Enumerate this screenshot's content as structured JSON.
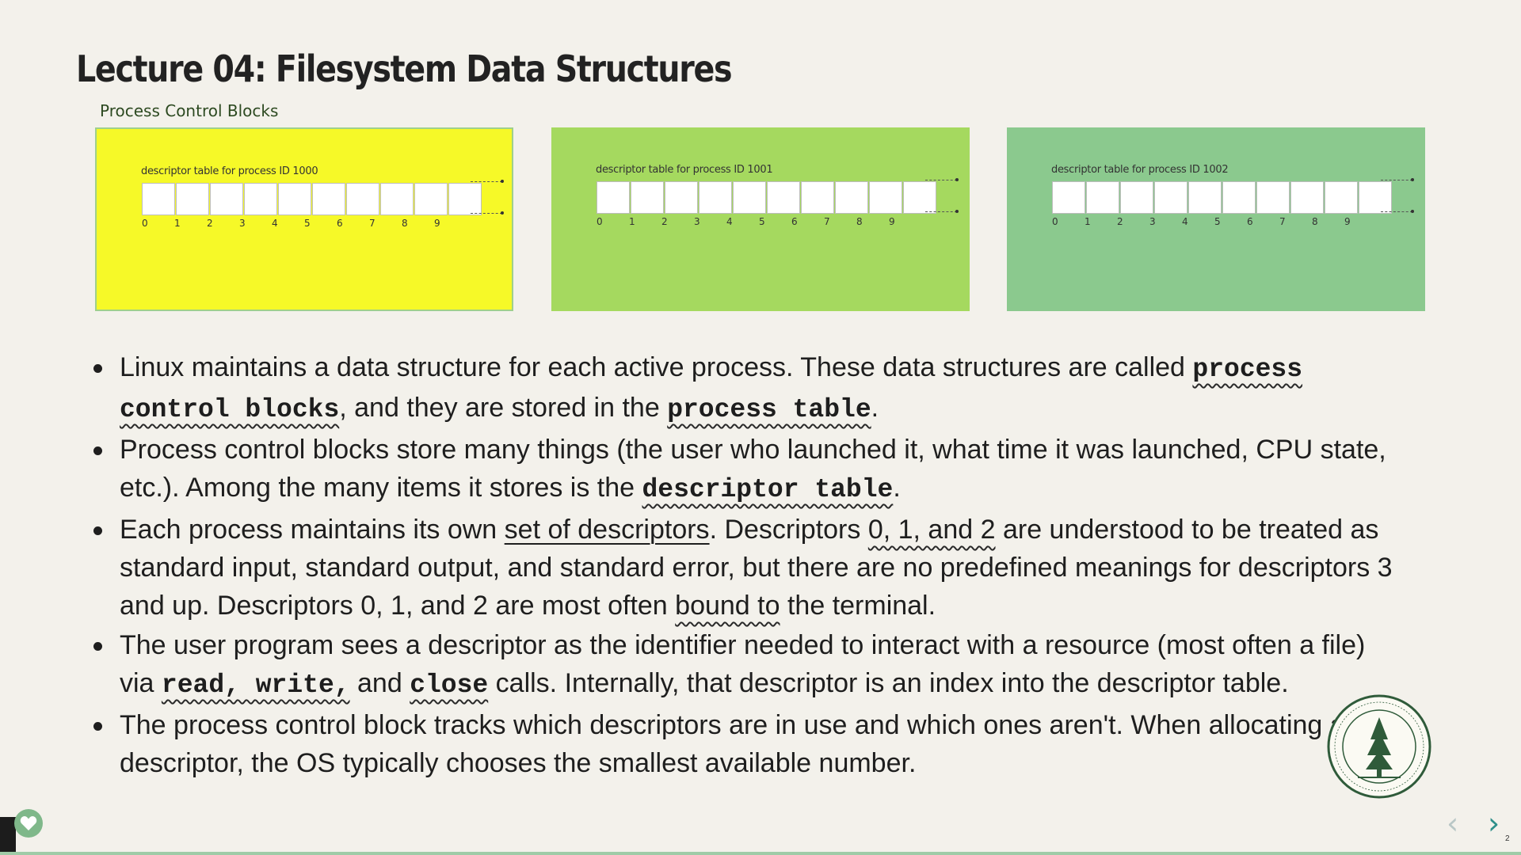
{
  "slide": {
    "title": "Lecture 04: Filesystem Data Structures",
    "pcb_label": "Process Control Blocks",
    "slide_number": "2"
  },
  "panels": [
    {
      "label": "descriptor table for process ID 1000",
      "color": "#f6f928"
    },
    {
      "label": "descriptor table for process ID 1001",
      "color": "#a5d95f"
    },
    {
      "label": "descriptor table for process ID 1002",
      "color": "#8bc98e"
    }
  ],
  "indices": [
    "0",
    "1",
    "2",
    "3",
    "4",
    "5",
    "6",
    "7",
    "8",
    "9"
  ],
  "bullets": {
    "b1": {
      "t1": "Linux maintains a data structure for each active process. These data structures are called ",
      "c1": "process control blocks",
      "t2": ", and they are stored in the ",
      "c2": "process table",
      "t3": "."
    },
    "b2": {
      "t1": "Process control blocks store many things (the user who launched it, what time it was launched, CPU state, etc.).  Among the many items it stores is the ",
      "c1": "descriptor table",
      "t2": "."
    },
    "b3": {
      "t1": "Each process maintains its own ",
      "u1": "set of descriptors",
      "t2": ". Descriptors ",
      "u2": "0, 1, and 2",
      "t3": " are understood to be treated as standard input, standard output, and standard error, but there are no predefined meanings for descriptors 3 and up. Descriptors 0, 1, and 2 are most often ",
      "u3": "bound to",
      "t4": " the terminal."
    },
    "b4": {
      "t1": "The user program sees a descriptor as the identifier needed to interact with a resource (most often a file) via ",
      "c1": "read, write,",
      "t2": " and ",
      "c2": "close",
      "t3": " calls. Internally, that descriptor is an index into the descriptor table."
    },
    "b5": {
      "t1": "The process control block tracks which descriptors are in use and which ones aren't. When allocating a new descriptor, the OS typically chooses the smallest available number."
    }
  },
  "icons": {
    "seal": "stanford-seal-icon",
    "prev": "chevron-left-icon",
    "next": "chevron-right-icon",
    "heart": "heart-icon"
  }
}
